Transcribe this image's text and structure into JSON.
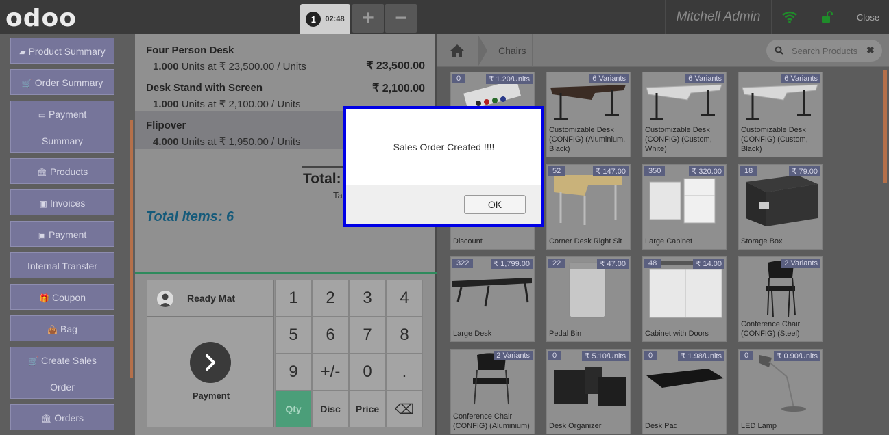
{
  "topbar": {
    "logo": "odoo",
    "order_number": "1",
    "order_time": "02:48",
    "add_label": "+",
    "remove_label": "−",
    "user_name": "Mitchell Admin",
    "close_label": "Close"
  },
  "sidebar": {
    "items": [
      {
        "label": "Product Summary"
      },
      {
        "label": "Order Summary"
      },
      {
        "label": "Payment"
      },
      {
        "label": "Summary"
      },
      {
        "label": "Products"
      },
      {
        "label": "Invoices"
      },
      {
        "label": "Payment"
      },
      {
        "label": "Internal Transfer"
      },
      {
        "label": "Coupon"
      },
      {
        "label": "Bag"
      },
      {
        "label": "Create Sales"
      },
      {
        "label": "Order"
      },
      {
        "label": "Orders"
      }
    ]
  },
  "order": {
    "lines": [
      {
        "name": "Four Person Desk",
        "qty": "1.000",
        "info": "Units at ₹ 23,500.00 / Units",
        "price": "₹ 23,500.00"
      },
      {
        "name": "Desk Stand with Screen",
        "qty": "1.000",
        "info": "Units at ₹ 2,100.00 / Units",
        "price": "₹ 2,100.00"
      },
      {
        "name": "Flipover",
        "qty": "4.000",
        "info": "Units at ₹ 1,950.00 / Units",
        "price": ""
      }
    ],
    "total_label": "Total:",
    "taxes_label": "Ta",
    "total_items": "Total Items: 6"
  },
  "controls": {
    "customer": "Ready Mat",
    "payment_label": "Payment",
    "keys": [
      [
        "1",
        "2",
        "3",
        "4"
      ],
      [
        "5",
        "6",
        "7",
        "8"
      ],
      [
        "9",
        "+/-",
        "0",
        "."
      ],
      [
        "Qty",
        "Disc",
        "Price",
        "⌫"
      ]
    ]
  },
  "products": {
    "breadcrumb": "Chairs",
    "search_placeholder": "Search Products",
    "items": [
      {
        "name": "",
        "left": "0",
        "right": "₹ 1.20/Units"
      },
      {
        "name": "Customizable Desk (CONFIG) (Aluminium, Black)",
        "left": "",
        "right": "6 Variants"
      },
      {
        "name": "Customizable Desk (CONFIG) (Custom, White)",
        "left": "",
        "right": "6 Variants"
      },
      {
        "name": "Customizable Desk (CONFIG) (Custom, Black)",
        "left": "",
        "right": "6 Variants"
      },
      {
        "name": "Discount",
        "left": "",
        "right": ""
      },
      {
        "name": "Corner Desk Right Sit",
        "left": "52",
        "right": "₹ 147.00"
      },
      {
        "name": "Large Cabinet",
        "left": "350",
        "right": "₹ 320.00"
      },
      {
        "name": "Storage Box",
        "left": "18",
        "right": "₹ 79.00"
      },
      {
        "name": "Large Desk",
        "left": "322",
        "right": "₹ 1,799.00"
      },
      {
        "name": "Pedal Bin",
        "left": "22",
        "right": "₹ 47.00"
      },
      {
        "name": "Cabinet with Doors",
        "left": "48",
        "right": "₹ 14.00"
      },
      {
        "name": "Conference Chair (CONFIG) (Steel)",
        "left": "",
        "right": "2 Variants"
      },
      {
        "name": "Conference Chair (CONFIG) (Aluminium)",
        "left": "",
        "right": "2 Variants"
      },
      {
        "name": "Desk Organizer",
        "left": "0",
        "right": "₹ 5.10/Units"
      },
      {
        "name": "Desk Pad",
        "left": "0",
        "right": "₹ 1.98/Units"
      },
      {
        "name": "LED Lamp",
        "left": "0",
        "right": "₹ 0.90/Units"
      }
    ]
  },
  "popup": {
    "message": "Sales Order Created !!!!",
    "ok_label": "OK"
  },
  "colors": {
    "accent_green": "#4b9e79",
    "sidebar_button": "#76759a",
    "popup_border": "#0000e6"
  }
}
